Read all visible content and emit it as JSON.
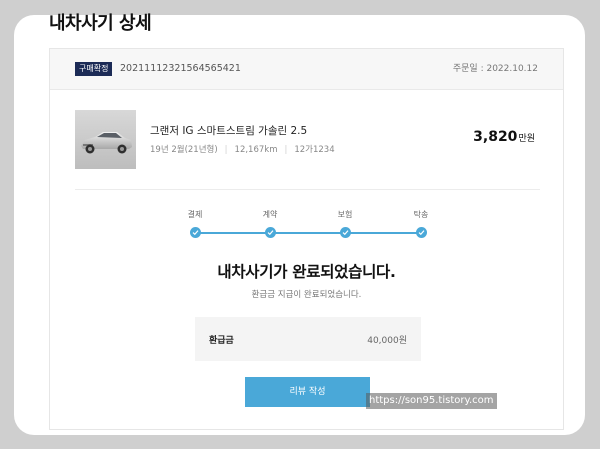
{
  "page": {
    "title": "내차사기 상세"
  },
  "order": {
    "status_badge": "구매확정",
    "number": "20211112321564565421",
    "date": "주문일 : 2022.10.12"
  },
  "car": {
    "name": "그랜저 IG 스마트스트림 가솔린 2.5",
    "year": "19년 2월(21년형)",
    "mileage": "12,167km",
    "plate": "12가1234",
    "price": "3,820",
    "price_unit": "만원",
    "thumbnail_icon": "car-photo"
  },
  "steps": {
    "items": [
      {
        "label": "결제"
      },
      {
        "label": "계약"
      },
      {
        "label": "보험"
      },
      {
        "label": "탁송"
      }
    ],
    "all_completed": true,
    "color": "#4aa8d8"
  },
  "completion": {
    "title": "내차사기가 완료되었습니다.",
    "subtitle": "환급금 지급이 완료되었습니다."
  },
  "refund": {
    "label": "환급금",
    "value": "40,000원"
  },
  "actions": {
    "review_label": "리뷰 작성"
  },
  "watermark": {
    "text": "https://son95.tistory.com"
  },
  "colors": {
    "accent": "#4aa8d8",
    "badge": "#1c2b56"
  }
}
